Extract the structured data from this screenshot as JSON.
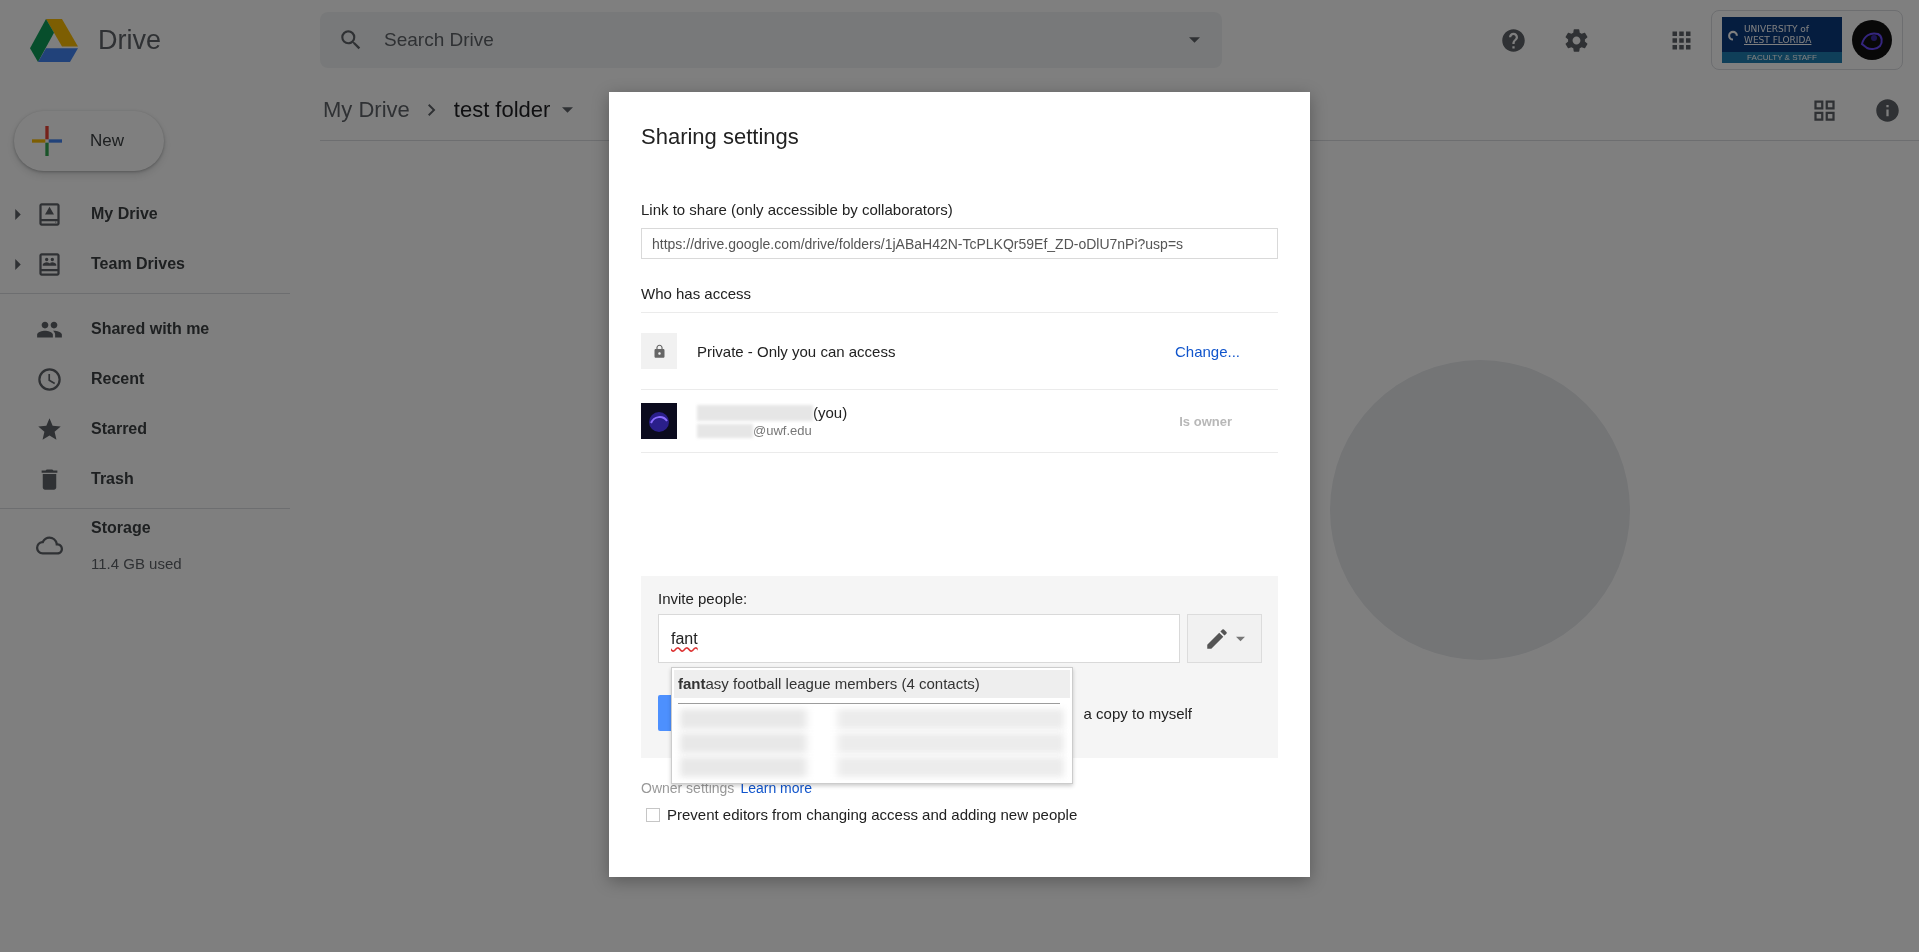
{
  "app": {
    "name": "Drive"
  },
  "search": {
    "placeholder": "Search Drive"
  },
  "account": {
    "org_lines": [
      "UNIVERSITY of",
      "WEST FLORIDA"
    ],
    "org_band": "FACULTY & STAFF"
  },
  "new_button": {
    "label": "New"
  },
  "sidebar": {
    "sections": [
      {
        "items": [
          {
            "label": "My Drive",
            "kind": "mydrive",
            "expandable": true
          },
          {
            "label": "Team Drives",
            "kind": "teamdrives",
            "expandable": true
          }
        ]
      },
      {
        "items": [
          {
            "label": "Shared with me",
            "kind": "shared",
            "expandable": false
          },
          {
            "label": "Recent",
            "kind": "recent",
            "expandable": false
          },
          {
            "label": "Starred",
            "kind": "starred",
            "expandable": false
          },
          {
            "label": "Trash",
            "kind": "trash",
            "expandable": false
          }
        ]
      },
      {
        "items": [
          {
            "label": "Storage",
            "kind": "storage",
            "expandable": false,
            "detail": "11.4 GB used"
          }
        ]
      }
    ]
  },
  "breadcrumb": [
    {
      "label": "My Drive"
    },
    {
      "label": "test folder"
    }
  ],
  "dialog": {
    "title": "Sharing settings",
    "link_label": "Link to share (only accessible by collaborators)",
    "link_value": "https://drive.google.com/drive/folders/1jABaH42N-TcPLKQr59Ef_ZD-oDlU7nPi?usp=s",
    "access_heading": "Who has access",
    "access_rows": [
      {
        "kind": "visibility",
        "text": "Private - Only you can access",
        "action": "Change..."
      },
      {
        "kind": "person",
        "name_suffix": "(you)",
        "email_suffix": "@uwf.edu",
        "role": "Is owner"
      }
    ],
    "invite": {
      "label": "Invite people:",
      "value": "fant",
      "visible_option_text": "a copy to myself",
      "suggestions": [
        {
          "kind": "match",
          "text": "**fant**asy football league members (4 contacts)",
          "highlighted": true
        },
        {
          "kind": "blurred",
          "highlighted": false
        },
        {
          "kind": "blurred",
          "highlighted": false
        },
        {
          "kind": "blurred",
          "highlighted": false
        }
      ]
    },
    "owner_settings": {
      "label": "Owner settings",
      "link": "Learn more",
      "option": {
        "label": "Prevent editors from changing access and adding new people",
        "checked": false
      }
    }
  }
}
